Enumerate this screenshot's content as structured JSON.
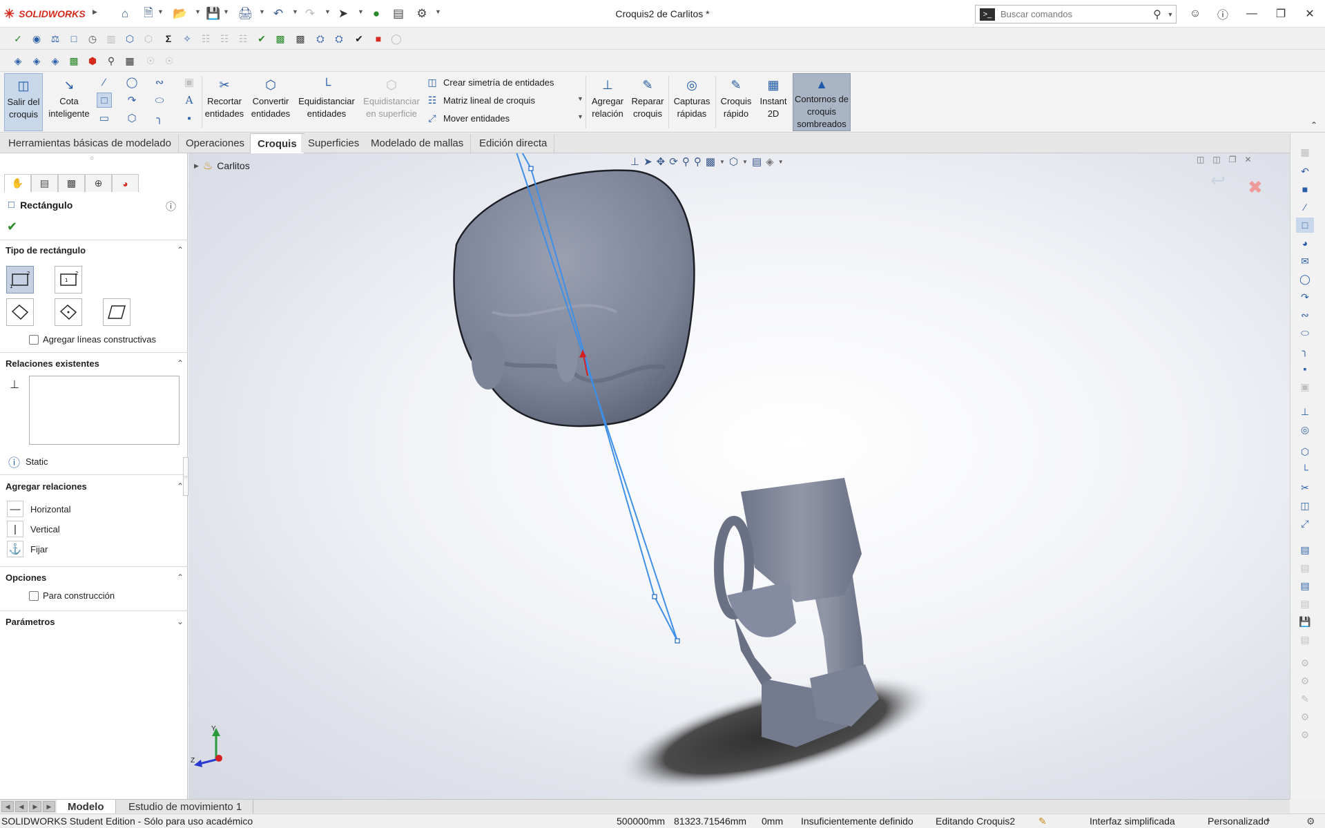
{
  "app": {
    "brand": "SOLIDWORKS",
    "document_title": "Croquis2 de Carlitos *"
  },
  "search": {
    "placeholder": "Buscar comandos"
  },
  "ribbon": {
    "exit_sketch": "Salir del croquis",
    "smart_dimension": "Cota inteligente",
    "trim": "Recortar entidades",
    "convert": "Convertir entidades",
    "offset": "Equidistanciar entidades",
    "offset_surface": "Equidistanciar en superficie",
    "mirror": "Crear simetría de entidades",
    "linear_pattern": "Matriz lineal de croquis",
    "move": "Mover entidades",
    "add_relation": "Agregar relación",
    "repair": "Reparar croquis",
    "quick_snaps": "Capturas rápidas",
    "rapid_sketch": "Croquis rápido",
    "instant2d": "Instant 2D",
    "shaded_contours": "Contornos de croquis sombreados"
  },
  "tabs": [
    {
      "label": "Herramientas básicas de modelado"
    },
    {
      "label": "Operaciones"
    },
    {
      "label": "Croquis"
    },
    {
      "label": "Superficies"
    },
    {
      "label": "Modelado de mallas"
    },
    {
      "label": "Edición directa"
    }
  ],
  "property_manager": {
    "title": "Rectángulo",
    "sections": {
      "rect_type": "Tipo de rectángulo",
      "existing_relations": "Relaciones existentes",
      "add_relations": "Agregar relaciones",
      "options": "Opciones",
      "parameters": "Parámetros"
    },
    "add_construction_lines": "Agregar líneas constructivas",
    "status": "Static",
    "relations": [
      {
        "label": "Horizontal"
      },
      {
        "label": "Vertical"
      },
      {
        "label": "Fijar"
      }
    ],
    "for_construction": "Para construcción"
  },
  "tree": {
    "root": "Carlitos"
  },
  "triad": {
    "y": "Y",
    "z": "Z"
  },
  "bottom_tabs": [
    {
      "label": "Modelo"
    },
    {
      "label": "Estudio de movimiento 1"
    }
  ],
  "status_bar": {
    "edition": "SOLIDWORKS Student Edition - Sólo para uso académico",
    "x": "500000mm",
    "y": "81323.71546mm",
    "z": "0mm",
    "definition": "Insuficientemente definido",
    "editing": "Editando Croquis2",
    "interface": "Interfaz simplificada",
    "custom": "Personalizado"
  },
  "colors": {
    "accent": "#1e5aa8",
    "brand_red": "#d52b1e",
    "model": "#7f8699",
    "sketch_line": "#3d8fe8"
  }
}
